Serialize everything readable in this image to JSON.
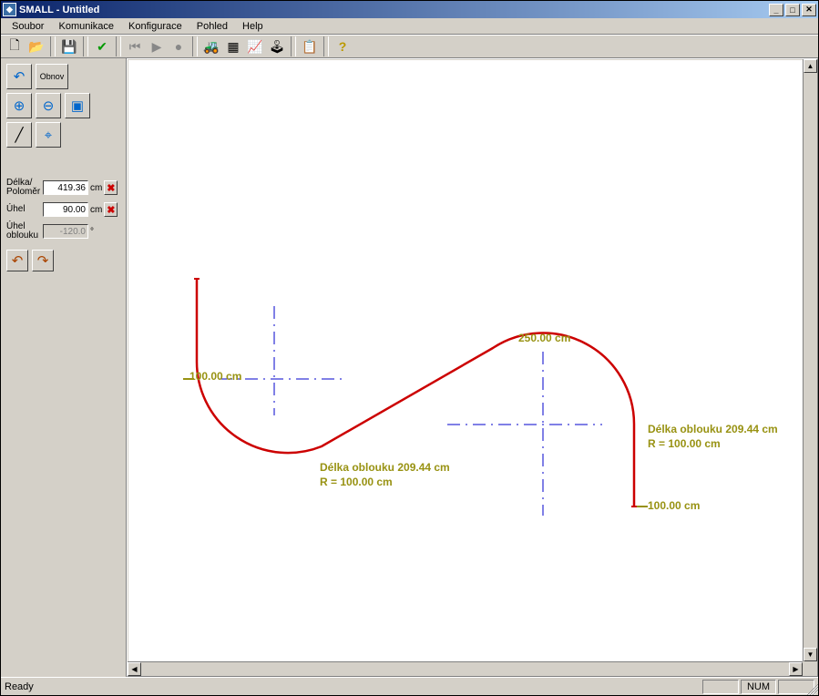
{
  "window": {
    "title": "SMALL - Untitled"
  },
  "menu": {
    "items": [
      "Soubor",
      "Komunikace",
      "Konfigurace",
      "Pohled",
      "Help"
    ]
  },
  "toolbar": {
    "buttons": [
      {
        "name": "new",
        "glyph": "🗋"
      },
      {
        "name": "open",
        "glyph": "📂"
      },
      {
        "name": "save",
        "glyph": "💾"
      },
      {
        "name": "validate",
        "glyph": "✔"
      },
      {
        "name": "rewind",
        "glyph": "⏮"
      },
      {
        "name": "play",
        "glyph": "▶"
      },
      {
        "name": "stop",
        "glyph": "●"
      },
      {
        "name": "vehicle",
        "glyph": "🚜"
      },
      {
        "name": "grid",
        "glyph": "▦"
      },
      {
        "name": "graph",
        "glyph": "📈"
      },
      {
        "name": "remote",
        "glyph": "🕹"
      },
      {
        "name": "note",
        "glyph": "📋"
      },
      {
        "name": "help",
        "glyph": "?"
      }
    ]
  },
  "sidebar": {
    "undo_tip": "↶",
    "obnov_label": "Obnov",
    "zoom": {
      "in": "⊕",
      "out": "⊖",
      "fit": "▣"
    },
    "tools": {
      "line": "╱",
      "target": "⌖"
    },
    "history": {
      "undo": "↶",
      "redo": "↷"
    },
    "props": {
      "length": {
        "label": "Délka/\nPoloměr",
        "value": "419.36",
        "unit": "cm"
      },
      "angle": {
        "label": "Úhel",
        "value": "90.00",
        "unit": "cm"
      },
      "arc": {
        "label": "Úhel\noblouku",
        "value": "-120.0",
        "unit": "°",
        "disabled": true
      }
    }
  },
  "canvas": {
    "labels": {
      "seg1": "100.00 cm",
      "seg2": "250.00 cm",
      "seg3": "100.00 cm",
      "arc1_line1": "Délka oblouku 209.44 cm",
      "arc1_line2": "R = 100.00 cm",
      "arc2_line1": "Délka oblouku 209.44 cm",
      "arc2_line2": "R = 100.00 cm"
    }
  },
  "status": {
    "ready": "Ready",
    "num": "NUM"
  }
}
